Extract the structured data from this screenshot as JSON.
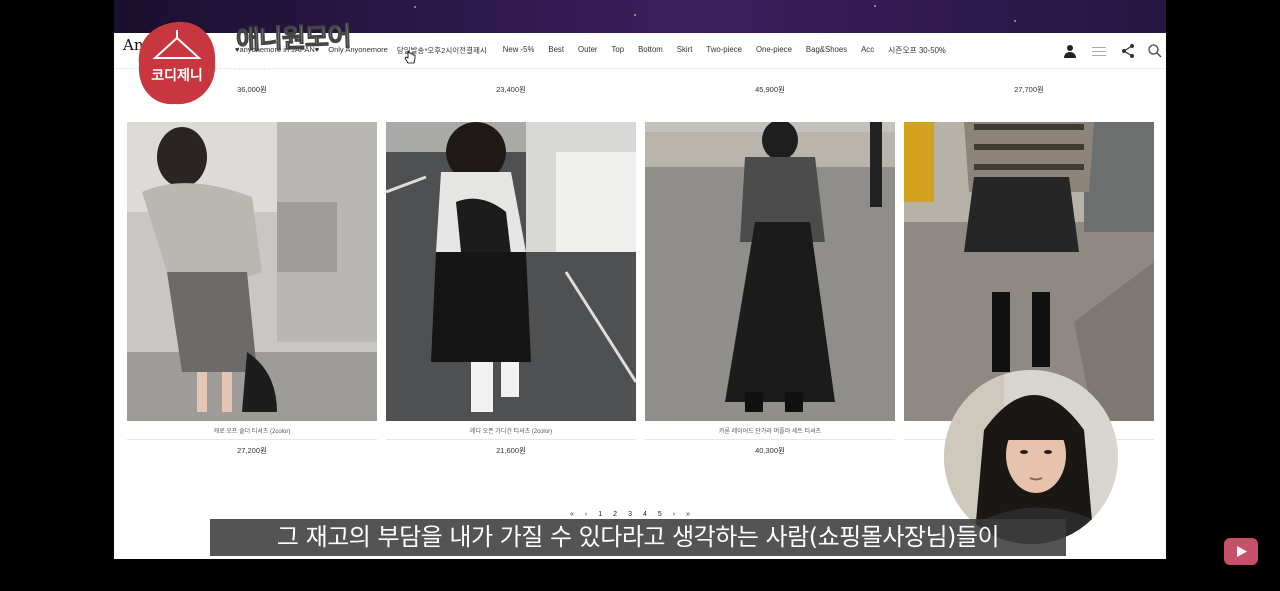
{
  "nav": {
    "logo": "An",
    "menu_promo": [
      "♥anyonemore in JAPAN♥",
      "Only Anyonemore",
      "당일발송*오후2시이전결제시"
    ],
    "categories": [
      "New -5%",
      "Best",
      "Outer",
      "Top",
      "Bottom",
      "Skirt",
      "Two-piece",
      "One-piece",
      "Bag&Shoes",
      "Acc",
      "시즌오프 30-50%"
    ]
  },
  "overlay": {
    "badge_text": "코디제니",
    "handwritten_title": "애니원모어"
  },
  "top_row": {
    "prices": [
      "36,000원",
      "23,400원",
      "45,900원",
      "27,700원"
    ]
  },
  "products": [
    {
      "name": "캐로 오프 숄더 티셔츠 (2color)",
      "price": "27,200원"
    },
    {
      "name": "레디 오픈 가디건 티셔츠 (2color)",
      "price": "21,600원"
    },
    {
      "name": "카론 레이어드 단가라 머플러 세트 티셔츠",
      "price": "40,300원"
    }
  ],
  "pagination": [
    "«",
    "‹",
    "1",
    "2",
    "3",
    "4",
    "5",
    "›",
    "»"
  ],
  "subtitle": "그 재고의 부담을 내가 가질 수 있다라고 생각하는 사람(쇼핑몰사장님)들이",
  "colors": {
    "badge": "#c8363f",
    "caption_bg": "#3c3c3c",
    "yt": "#c6506a"
  }
}
